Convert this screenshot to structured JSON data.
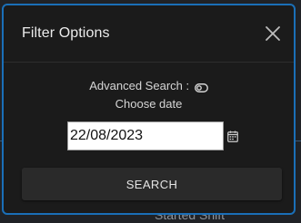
{
  "background": {
    "peek_text": "Started Shift"
  },
  "dialog": {
    "title": "Filter Options",
    "close_icon": "close-icon",
    "advanced_search_label": "Advanced Search :",
    "toggle_icon": "toggle-off-icon",
    "choose_date_label": "Choose date",
    "date_value": "22/08/2023",
    "calendar_icon": "calendar-icon",
    "search_button_label": "SEARCH"
  },
  "colors": {
    "dialog_border": "#1a6fb8",
    "dialog_bg": "#1b1b1b",
    "button_bg": "#2a2a2a"
  }
}
